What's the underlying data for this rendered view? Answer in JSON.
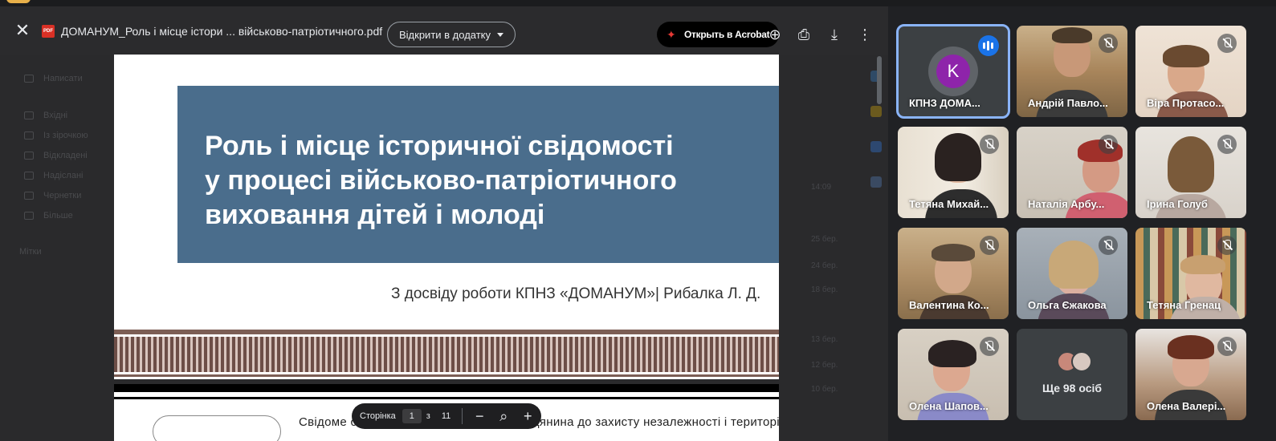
{
  "viewer": {
    "file_name": "ДОМАНУМ_Роль і місце істори ... військово-патріотичного.pdf",
    "pdf_badge": "PDF",
    "open_in_app_label": "Відкрити в додатку",
    "acrobat_label": "Открыть в Acrobat",
    "icons": [
      "close-icon",
      "add-to-drive-icon",
      "print-icon",
      "download-icon",
      "more-vert-icon"
    ]
  },
  "background_app": {
    "sidebar": [
      "Написати",
      "Вхідні",
      "Із зірочкою",
      "Відкладені",
      "Надіслані",
      "Чернетки",
      "Більше"
    ],
    "labels_heading": "Мітки",
    "dates": [
      "14:09",
      "25 бер.",
      "24 бер.",
      "18 бер.",
      "13 бер.",
      "12 бер.",
      "10 бер."
    ]
  },
  "slide": {
    "title_line1": "Роль і місце історичної свідомості",
    "title_line2": "у  процесі військово-патріотичного",
    "title_line3": "виховання дітей і молоді",
    "author": "З досвіду роботи КПНЗ «ДОМАНУМ»| Рибалка Л. Д.",
    "page2_text": "Свідоме сприйняття та готовність громадянина до захисту незалежності і територіальної"
  },
  "page_nav": {
    "label": "Сторінка",
    "current": "1",
    "separator": "з",
    "total": "11",
    "zoom_out": "−",
    "zoom_icon": "⌕",
    "zoom_in": "+"
  },
  "participants": [
    {
      "name": "КПНЗ ДОМА...",
      "avatar_letter": "K",
      "speaking": true
    },
    {
      "name": "Андрій Павло...",
      "muted": true
    },
    {
      "name": "Віра Протасо...",
      "muted": true
    },
    {
      "name": "Тетяна Михай...",
      "muted": true
    },
    {
      "name": "Наталія Арбу...",
      "muted": true
    },
    {
      "name": "Ірина Голуб",
      "muted": true
    },
    {
      "name": "Валентина Ко...",
      "muted": true
    },
    {
      "name": "Ольга Єжакова",
      "muted": true
    },
    {
      "name": "Тетяна Гренац",
      "muted": true
    },
    {
      "name": "Олена Шапов...",
      "muted": true
    },
    {
      "more_label": "Ще 98 осіб"
    },
    {
      "name": "Олена Валері...",
      "muted": true
    }
  ],
  "colors": {
    "slide_blue": "#4a6d8c",
    "active_outline": "#8ab4f8",
    "speaking_blue": "#1a73e8",
    "avatar_purple": "#8e24aa"
  }
}
